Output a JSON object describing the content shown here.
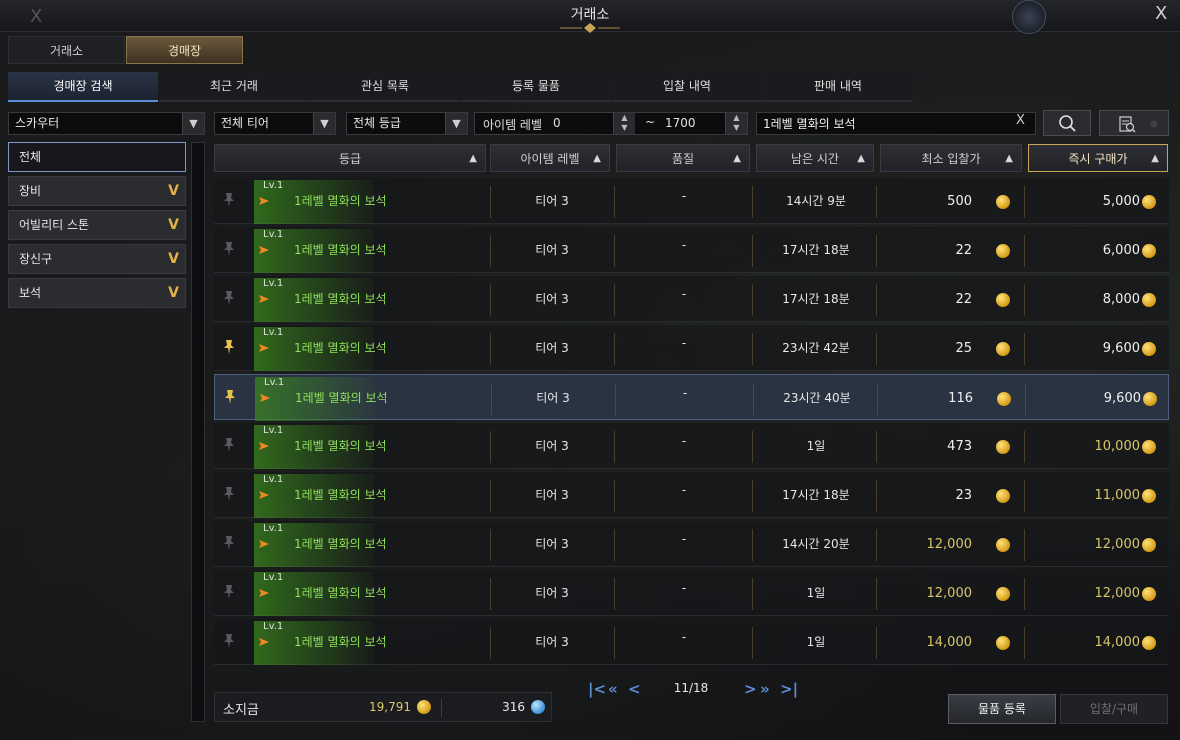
{
  "window": {
    "title": "거래소",
    "close_left": "X",
    "close_right": "X"
  },
  "main_tabs": [
    {
      "label": "거래소"
    },
    {
      "label": "경매장"
    }
  ],
  "sub_tabs": [
    {
      "label": "경매장 검색"
    },
    {
      "label": "최근 거래"
    },
    {
      "label": "관심 목록"
    },
    {
      "label": "등록 물품"
    },
    {
      "label": "입찰 내역"
    },
    {
      "label": "판매 내역"
    }
  ],
  "filters": {
    "class_select": "스카우터",
    "tier_select": "전체 티어",
    "grade_select": "전체 등급",
    "item_level_label": "아이템 레벨",
    "item_level_min": "0",
    "item_level_tilde": "~",
    "item_level_max": "1700",
    "search_text": "1레벨 멸화의 보석",
    "clear_label": "X"
  },
  "categories": [
    {
      "label": "전체"
    },
    {
      "label": "장비"
    },
    {
      "label": "어빌리티 스톤"
    },
    {
      "label": "장신구"
    },
    {
      "label": "보석"
    }
  ],
  "table": {
    "headers": [
      "등급",
      "아이템 레벨",
      "품질",
      "남은 시간",
      "최소 입찰가",
      "즉시 구매가"
    ],
    "rows": [
      {
        "lv": "Lv.1",
        "name": "1레벨 멸화의 보석",
        "tier": "티어 3",
        "quality": "-",
        "time": "14시간 9분",
        "min_bid": "500",
        "buy_now": "5,000",
        "favorite": false
      },
      {
        "lv": "Lv.1",
        "name": "1레벨 멸화의 보석",
        "tier": "티어 3",
        "quality": "-",
        "time": "17시간 18분",
        "min_bid": "22",
        "buy_now": "6,000",
        "favorite": false
      },
      {
        "lv": "Lv.1",
        "name": "1레벨 멸화의 보석",
        "tier": "티어 3",
        "quality": "-",
        "time": "17시간 18분",
        "min_bid": "22",
        "buy_now": "8,000",
        "favorite": false
      },
      {
        "lv": "Lv.1",
        "name": "1레벨 멸화의 보석",
        "tier": "티어 3",
        "quality": "-",
        "time": "23시간 42분",
        "min_bid": "25",
        "buy_now": "9,600",
        "favorite": true
      },
      {
        "lv": "Lv.1",
        "name": "1레벨 멸화의 보석",
        "tier": "티어 3",
        "quality": "-",
        "time": "23시간 40분",
        "min_bid": "116",
        "buy_now": "9,600",
        "favorite": true
      },
      {
        "lv": "Lv.1",
        "name": "1레벨 멸화의 보석",
        "tier": "티어 3",
        "quality": "-",
        "time": "1일",
        "min_bid": "473",
        "buy_now": "10,000",
        "favorite": false
      },
      {
        "lv": "Lv.1",
        "name": "1레벨 멸화의 보석",
        "tier": "티어 3",
        "quality": "-",
        "time": "17시간 18분",
        "min_bid": "23",
        "buy_now": "11,000",
        "favorite": false
      },
      {
        "lv": "Lv.1",
        "name": "1레벨 멸화의 보석",
        "tier": "티어 3",
        "quality": "-",
        "time": "14시간 20분",
        "min_bid": "12,000",
        "buy_now": "12,000",
        "favorite": false
      },
      {
        "lv": "Lv.1",
        "name": "1레벨 멸화의 보석",
        "tier": "티어 3",
        "quality": "-",
        "time": "1일",
        "min_bid": "12,000",
        "buy_now": "12,000",
        "favorite": false
      },
      {
        "lv": "Lv.1",
        "name": "1레벨 멸화의 보석",
        "tier": "티어 3",
        "quality": "-",
        "time": "1일",
        "min_bid": "14,000",
        "buy_now": "14,000",
        "favorite": false
      }
    ]
  },
  "wallet": {
    "label": "소지금",
    "gold": "19,791",
    "blue_crystal": "316"
  },
  "pager": {
    "text": "11/18",
    "first": "K",
    "prev_fast": "«",
    "prev": "<",
    "next": ">",
    "next_fast": "»",
    "last": "K"
  },
  "buttons": {
    "register": "물품 등록",
    "bid_buy": "입찰/구매"
  },
  "colors": {
    "accent_gold": "#c9a55a",
    "item_name_green": "#8ee05a",
    "selected_row": "#2a3342",
    "tab_accent_blue": "#5b8ed4"
  }
}
